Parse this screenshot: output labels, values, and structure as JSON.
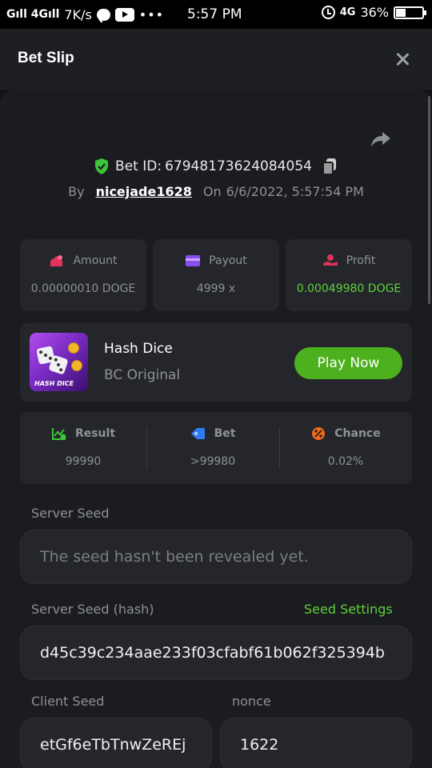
{
  "status_bar": {
    "network": "Gıll 4Gıll",
    "speed": "7K/s",
    "time": "5:57 PM",
    "net_type": "4G",
    "battery": "36%",
    "battery_level": 0.36
  },
  "header": {
    "title": "Bet Slip"
  },
  "bet": {
    "bet_id_label": "Bet ID:",
    "bet_id": "67948173624084054",
    "by_label": "By",
    "username": "nicejade1628",
    "on_label": "On",
    "date": "6/6/2022, 5:57:54 PM"
  },
  "stats": {
    "amount_label": "Amount",
    "amount_value": "0.00000010 DOGE",
    "payout_label": "Payout",
    "payout_value": "4999 x",
    "profit_label": "Profit",
    "profit_value": "0.00049980 DOGE"
  },
  "game": {
    "name": "Hash Dice",
    "subtitle": "BC Original",
    "thumb_label": "HASH DICE",
    "play_label": "Play Now"
  },
  "result": {
    "result_label": "Result",
    "result_value": "99990",
    "bet_label": "Bet",
    "bet_value": ">99980",
    "chance_label": "Chance",
    "chance_value": "0.02%"
  },
  "fairness": {
    "server_seed_label": "Server Seed",
    "server_seed_placeholder": "The seed hasn't been revealed yet.",
    "server_hash_label": "Server Seed (hash)",
    "seed_settings_label": "Seed Settings",
    "server_hash_value": "d45c39c234aae233f03cfabf61b062f325394b",
    "client_seed_label": "Client Seed",
    "client_seed_value": "etGf6eTbTnwZeREj",
    "nonce_label": "nonce",
    "nonce_value": "1622"
  },
  "colors": {
    "accent_green": "#4cb01f",
    "profit_green": "#5fd13a",
    "card_bg": "#24262b",
    "panel_bg": "#1b1c20"
  },
  "icons": [
    "shield-check-icon",
    "copy-icon",
    "share-icon",
    "close-icon",
    "amount-icon",
    "payout-card-icon",
    "profit-icon",
    "result-chart-icon",
    "bet-tag-icon",
    "chance-percent-icon"
  ]
}
